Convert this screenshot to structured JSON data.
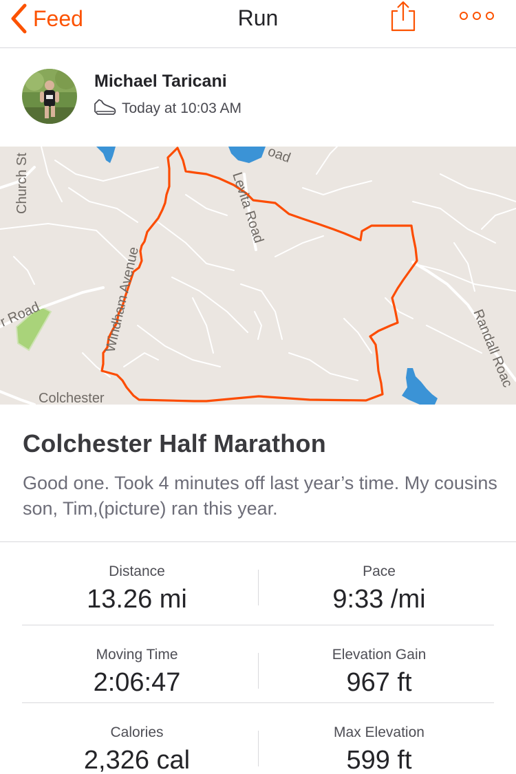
{
  "nav": {
    "back_label": "Feed",
    "title": "Run",
    "share_icon": "share-icon",
    "more_icon": "more-icon",
    "accent_color": "#fc5200"
  },
  "athlete": {
    "name": "Michael Taricani",
    "activity_icon": "shoe-icon",
    "timestamp": "Today at 10:03 AM"
  },
  "map": {
    "labels": {
      "church_st": "Church St",
      "road_top": "oad",
      "levita_road": "Levita Road",
      "windham_avenue": "Windham Avenue",
      "road_left": "r Road",
      "colchester": "Colchester",
      "randall_road": "Randall Roac"
    },
    "route_color": "#fc4c02",
    "water_color": "#3b93d6",
    "park_color": "#a9d37a"
  },
  "activity": {
    "title": "Colchester Half Marathon",
    "description": "Good one. Took 4 minutes off last year’s time. My cousins son, Tim,(picture) ran this year."
  },
  "stats": [
    {
      "label": "Distance",
      "value": "13.26 mi"
    },
    {
      "label": "Pace",
      "value": "9:33 /mi"
    },
    {
      "label": "Moving Time",
      "value": "2:06:47"
    },
    {
      "label": "Elevation Gain",
      "value": "967 ft"
    },
    {
      "label": "Calories",
      "value": "2,326 cal"
    },
    {
      "label": "Max Elevation",
      "value": "599 ft"
    }
  ]
}
